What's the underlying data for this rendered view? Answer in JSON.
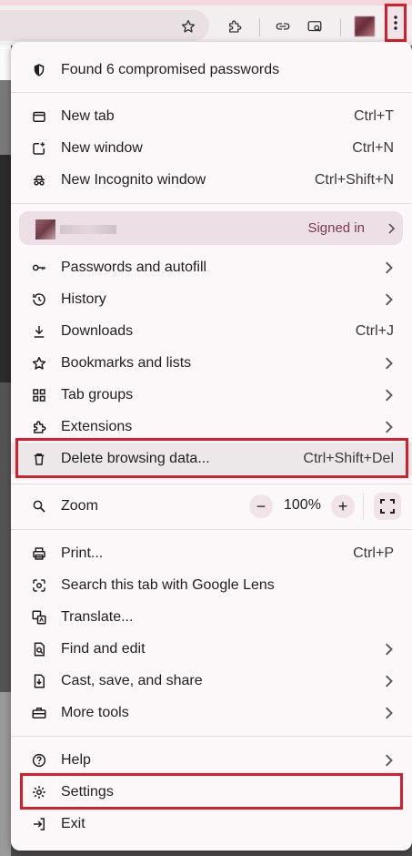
{
  "toolbar": {
    "icons": [
      "star-icon",
      "extensions-icon",
      "link-icon",
      "search-panel-icon",
      "avatar",
      "more-menu-icon"
    ]
  },
  "menu": {
    "alert": "Found 6 compromised passwords",
    "new_tab": {
      "label": "New tab",
      "shortcut": "Ctrl+T"
    },
    "new_window": {
      "label": "New window",
      "shortcut": "Ctrl+N"
    },
    "new_incognito": {
      "label": "New Incognito window",
      "shortcut": "Ctrl+Shift+N"
    },
    "profile": {
      "status": "Signed in"
    },
    "passwords": {
      "label": "Passwords and autofill"
    },
    "history": {
      "label": "History"
    },
    "downloads": {
      "label": "Downloads",
      "shortcut": "Ctrl+J"
    },
    "bookmarks": {
      "label": "Bookmarks and lists"
    },
    "tab_groups": {
      "label": "Tab groups"
    },
    "extensions": {
      "label": "Extensions"
    },
    "delete_data": {
      "label": "Delete browsing data...",
      "shortcut": "Ctrl+Shift+Del"
    },
    "zoom": {
      "label": "Zoom",
      "minus": "−",
      "value": "100%",
      "plus": "+"
    },
    "print": {
      "label": "Print...",
      "shortcut": "Ctrl+P"
    },
    "lens": {
      "label": "Search this tab with Google Lens"
    },
    "translate": {
      "label": "Translate..."
    },
    "find_edit": {
      "label": "Find and edit"
    },
    "cast_save": {
      "label": "Cast, save, and share"
    },
    "more_tools": {
      "label": "More tools"
    },
    "help": {
      "label": "Help"
    },
    "settings": {
      "label": "Settings"
    },
    "exit": {
      "label": "Exit"
    }
  },
  "colors": {
    "highlight": "#d81e2a",
    "accent": "#7a3b4a",
    "menu_bg": "#fcf7f9"
  }
}
